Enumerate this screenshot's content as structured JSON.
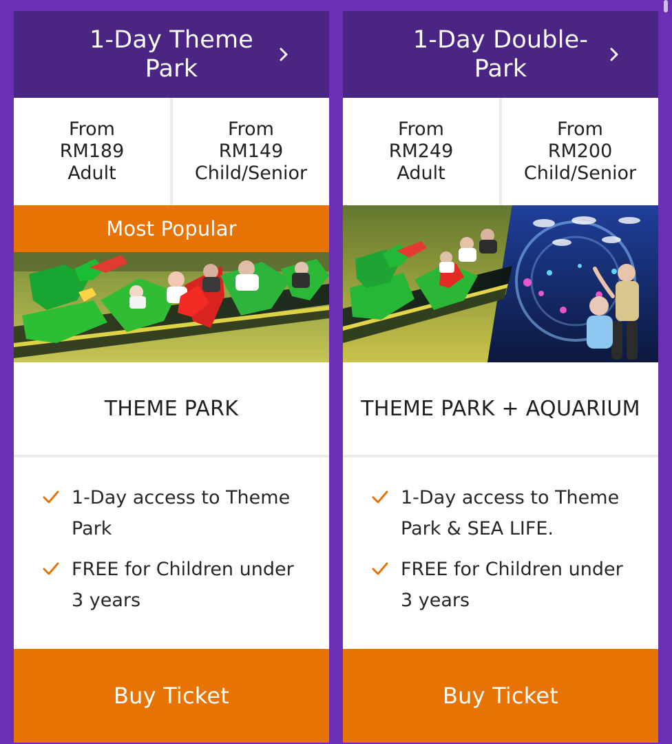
{
  "cards": [
    {
      "title": "1-Day Theme Park",
      "prices": [
        {
          "prefix": "From",
          "amount": "RM189",
          "audience": "Adult"
        },
        {
          "prefix": "From",
          "amount": "RM149",
          "audience": "Child/Senior"
        }
      ],
      "ribbon": "Most Popular",
      "category": "THEME PARK",
      "features": [
        "1-Day access to Theme Park",
        "FREE for Children under 3 years"
      ],
      "button": "Buy Ticket"
    },
    {
      "title": "1-Day Double-Park",
      "prices": [
        {
          "prefix": "From",
          "amount": "RM249",
          "audience": "Adult"
        },
        {
          "prefix": "From",
          "amount": "RM200",
          "audience": "Child/Senior"
        }
      ],
      "category": "THEME PARK + AQUARIUM",
      "features": [
        "1-Day access to Theme Park & SEA LIFE.",
        "FREE for Children under 3 years"
      ],
      "button": "Buy Ticket"
    }
  ],
  "colors": {
    "background": "#6b2fb3",
    "header": "#4a2583",
    "accent": "#e67304",
    "divider": "#ececec"
  },
  "icons": {
    "chevron": "chevron-right-icon",
    "check": "check-icon"
  }
}
